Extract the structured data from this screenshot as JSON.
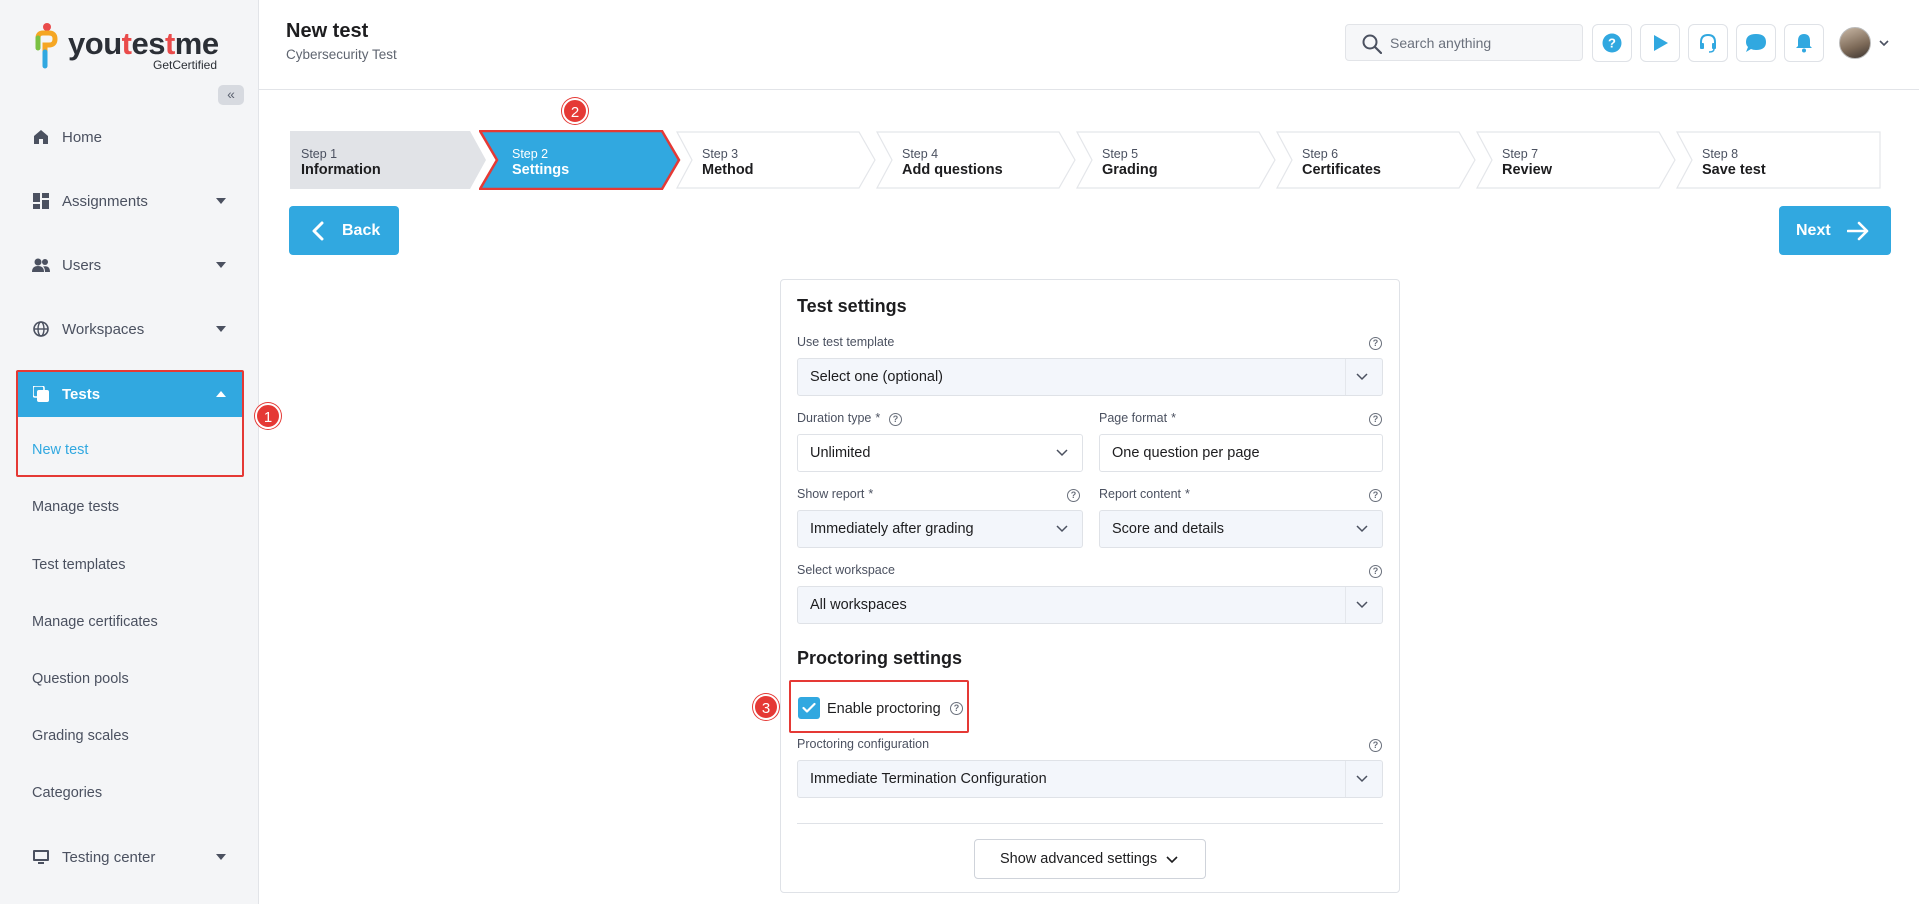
{
  "app": {
    "logo_text": "youtestme",
    "logo_sub": "GetCertified"
  },
  "sidebar": {
    "collapse_icon": "«",
    "items": [
      {
        "label": "Home",
        "icon": "home-icon"
      },
      {
        "label": "Assignments",
        "icon": "dashboard-icon"
      },
      {
        "label": "Users",
        "icon": "users-icon"
      },
      {
        "label": "Workspaces",
        "icon": "globe-icon"
      },
      {
        "label": "Tests",
        "icon": "tests-icon"
      },
      {
        "label": "Testing center",
        "icon": "monitor-icon"
      }
    ],
    "sub_items": [
      {
        "label": "New test"
      },
      {
        "label": "Manage tests"
      },
      {
        "label": "Test templates"
      },
      {
        "label": "Manage certificates"
      },
      {
        "label": "Question pools"
      },
      {
        "label": "Grading scales"
      },
      {
        "label": "Categories"
      }
    ]
  },
  "header": {
    "title": "New test",
    "subtitle": "Cybersecurity Test",
    "search_placeholder": "Search anything",
    "buttons": [
      "help-icon",
      "play-icon",
      "headset-icon",
      "chat-icon",
      "bell-icon"
    ]
  },
  "steps": [
    {
      "num": "Step 1",
      "name": "Information"
    },
    {
      "num": "Step 2",
      "name": "Settings"
    },
    {
      "num": "Step 3",
      "name": "Method"
    },
    {
      "num": "Step 4",
      "name": "Add questions"
    },
    {
      "num": "Step 5",
      "name": "Grading"
    },
    {
      "num": "Step 6",
      "name": "Certificates"
    },
    {
      "num": "Step 7",
      "name": "Review"
    },
    {
      "num": "Step 8",
      "name": "Save test"
    }
  ],
  "nav_buttons": {
    "back": "Back",
    "next": "Next"
  },
  "annotations": [
    "1",
    "2",
    "3"
  ],
  "form": {
    "test_settings_title": "Test settings",
    "template_label": "Use test template",
    "template_value": "Select one (optional)",
    "duration_label": "Duration type",
    "duration_value": "Unlimited",
    "page_format_label": "Page format",
    "page_format_value": "One question per page",
    "show_report_label": "Show report",
    "show_report_value": "Immediately after grading",
    "report_content_label": "Report content",
    "report_content_value": "Score and details",
    "workspace_label": "Select workspace",
    "workspace_value": "All workspaces",
    "required_mark": "*",
    "proctoring_title": "Proctoring settings",
    "enable_proctoring_label": "Enable proctoring",
    "enable_proctoring_checked": true,
    "proctoring_config_label": "Proctoring configuration",
    "proctoring_config_value": "Immediate Termination Configuration",
    "advanced_button": "Show advanced settings"
  },
  "colors": {
    "accent": "#31a8e0",
    "annotation_red": "#e53935"
  }
}
